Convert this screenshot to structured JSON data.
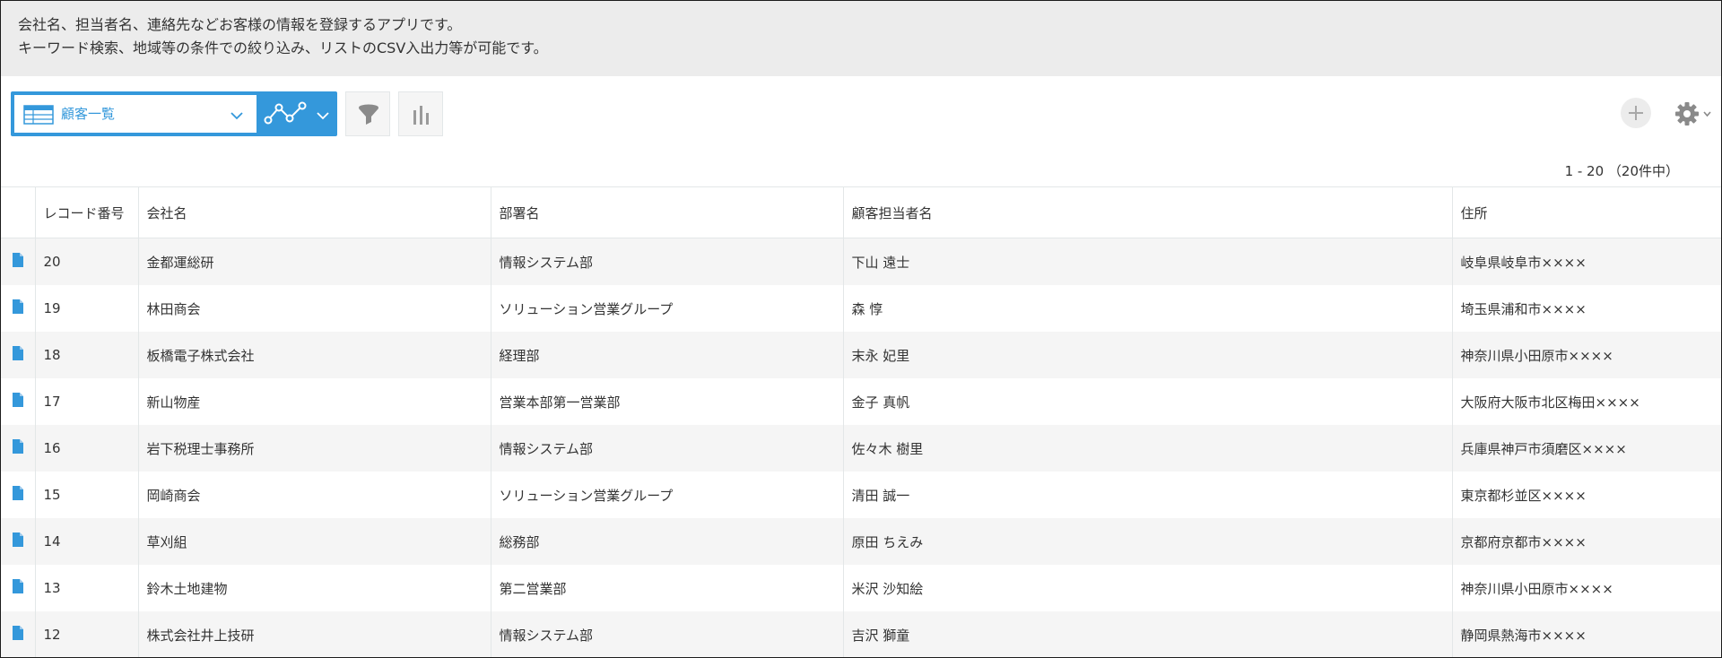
{
  "description": {
    "line1": "会社名、担当者名、連絡先などお客様の情報を登録するアプリです。",
    "line2": "キーワード検索、地域等の条件での絞り込み、リストのCSV入出力等が可能です。"
  },
  "toolbar": {
    "view_name": "顧客一覧"
  },
  "pagination": "1 - 20 （20件中）",
  "columns": [
    "",
    "レコード番号",
    "会社名",
    "部署名",
    "顧客担当者名",
    "住所"
  ],
  "rows": [
    {
      "id": "20",
      "company": "金都運総研",
      "dept": "情報システム部",
      "contact": "下山 遠士",
      "address": "岐阜県岐阜市××××"
    },
    {
      "id": "19",
      "company": "林田商会",
      "dept": "ソリューション営業グループ",
      "contact": "森 惇",
      "address": "埼玉県浦和市××××"
    },
    {
      "id": "18",
      "company": "板橋電子株式会社",
      "dept": "経理部",
      "contact": "末永 妃里",
      "address": "神奈川県小田原市××××"
    },
    {
      "id": "17",
      "company": "新山物産",
      "dept": "営業本部第一営業部",
      "contact": "金子 真帆",
      "address": "大阪府大阪市北区梅田××××"
    },
    {
      "id": "16",
      "company": "岩下税理士事務所",
      "dept": "情報システム部",
      "contact": "佐々木 樹里",
      "address": "兵庫県神戸市須磨区××××"
    },
    {
      "id": "15",
      "company": "岡崎商会",
      "dept": "ソリューション営業グループ",
      "contact": "清田 誠一",
      "address": "東京都杉並区××××"
    },
    {
      "id": "14",
      "company": "草刈組",
      "dept": "総務部",
      "contact": "原田 ちえみ",
      "address": "京都府京都市××××"
    },
    {
      "id": "13",
      "company": "鈴木土地建物",
      "dept": "第二営業部",
      "contact": "米沢 沙知絵",
      "address": "神奈川県小田原市××××"
    },
    {
      "id": "12",
      "company": "株式会社井上技研",
      "dept": "情報システム部",
      "contact": "吉沢 獅童",
      "address": "静岡県熱海市××××"
    }
  ],
  "icons": {
    "view_icon": "table-grid-icon",
    "graph_icon": "line-graph-icon",
    "filter_icon": "filter-icon",
    "chart_icon": "bar-chart-icon",
    "add_icon": "plus-icon",
    "settings_icon": "gear-icon",
    "record_icon": "document-icon"
  },
  "colors": {
    "accent": "#3498db",
    "header_band": "#ececec",
    "row_alt": "#f5f5f5",
    "border": "#e3e7e8"
  }
}
